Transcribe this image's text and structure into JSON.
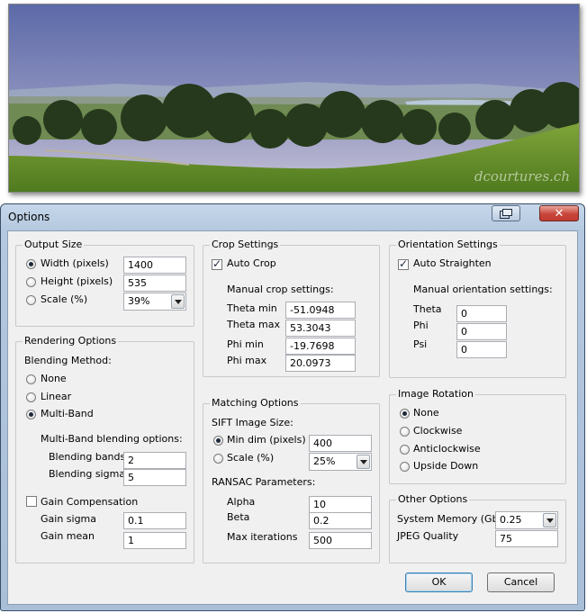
{
  "panorama": {
    "watermark": "dcourtures.ch"
  },
  "window": {
    "title": "Options"
  },
  "output_size": {
    "title": "Output Size",
    "width_label": "Width (pixels)",
    "width_value": "1400",
    "height_label": "Height (pixels)",
    "height_value": "535",
    "scale_label": "Scale (%)",
    "scale_value": "39%",
    "selected": "width"
  },
  "rendering": {
    "title": "Rendering Options",
    "blending_method_label": "Blending Method:",
    "none_label": "None",
    "linear_label": "Linear",
    "multiband_label": "Multi-Band",
    "selected": "multiband",
    "multiband_options_label": "Multi-Band blending options:",
    "bands_label": "Blending bands",
    "bands_value": "2",
    "sigma_label": "Blending sigma",
    "sigma_value": "5",
    "gain_comp_label": "Gain Compensation",
    "gain_comp_checked": false,
    "gain_sigma_label": "Gain sigma",
    "gain_sigma_value": "0.1",
    "gain_mean_label": "Gain mean",
    "gain_mean_value": "1"
  },
  "crop": {
    "title": "Crop Settings",
    "auto_crop_label": "Auto Crop",
    "auto_crop_checked": true,
    "manual_label": "Manual crop settings:",
    "theta_min_label": "Theta min",
    "theta_min_value": "-51.0948",
    "theta_max_label": "Theta max",
    "theta_max_value": "53.3043",
    "phi_min_label": "Phi min",
    "phi_min_value": "-19.7698",
    "phi_max_label": "Phi max",
    "phi_max_value": "20.0973"
  },
  "matching": {
    "title": "Matching Options",
    "sift_label": "SIFT Image Size:",
    "min_dim_label": "Min dim (pixels)",
    "min_dim_value": "400",
    "scale_label": "Scale (%)",
    "scale_value": "25%",
    "selected": "min_dim",
    "ransac_label": "RANSAC Parameters:",
    "alpha_label": "Alpha",
    "alpha_value": "10",
    "beta_label": "Beta",
    "beta_value": "0.2",
    "max_iter_label": "Max iterations",
    "max_iter_value": "500"
  },
  "orientation": {
    "title": "Orientation Settings",
    "auto_straighten_label": "Auto Straighten",
    "auto_straighten_checked": true,
    "manual_label": "Manual orientation settings:",
    "theta_label": "Theta",
    "theta_value": "0",
    "phi_label": "Phi",
    "phi_value": "0",
    "psi_label": "Psi",
    "psi_value": "0"
  },
  "rotation": {
    "title": "Image Rotation",
    "none_label": "None",
    "clockwise_label": "Clockwise",
    "anticlockwise_label": "Anticlockwise",
    "upside_down_label": "Upside Down",
    "selected": "none"
  },
  "other": {
    "title": "Other Options",
    "memory_label": "System Memory (Gb)",
    "memory_value": "0.25",
    "jpeg_label": "JPEG Quality",
    "jpeg_value": "75"
  },
  "buttons": {
    "ok": "OK",
    "cancel": "Cancel"
  }
}
